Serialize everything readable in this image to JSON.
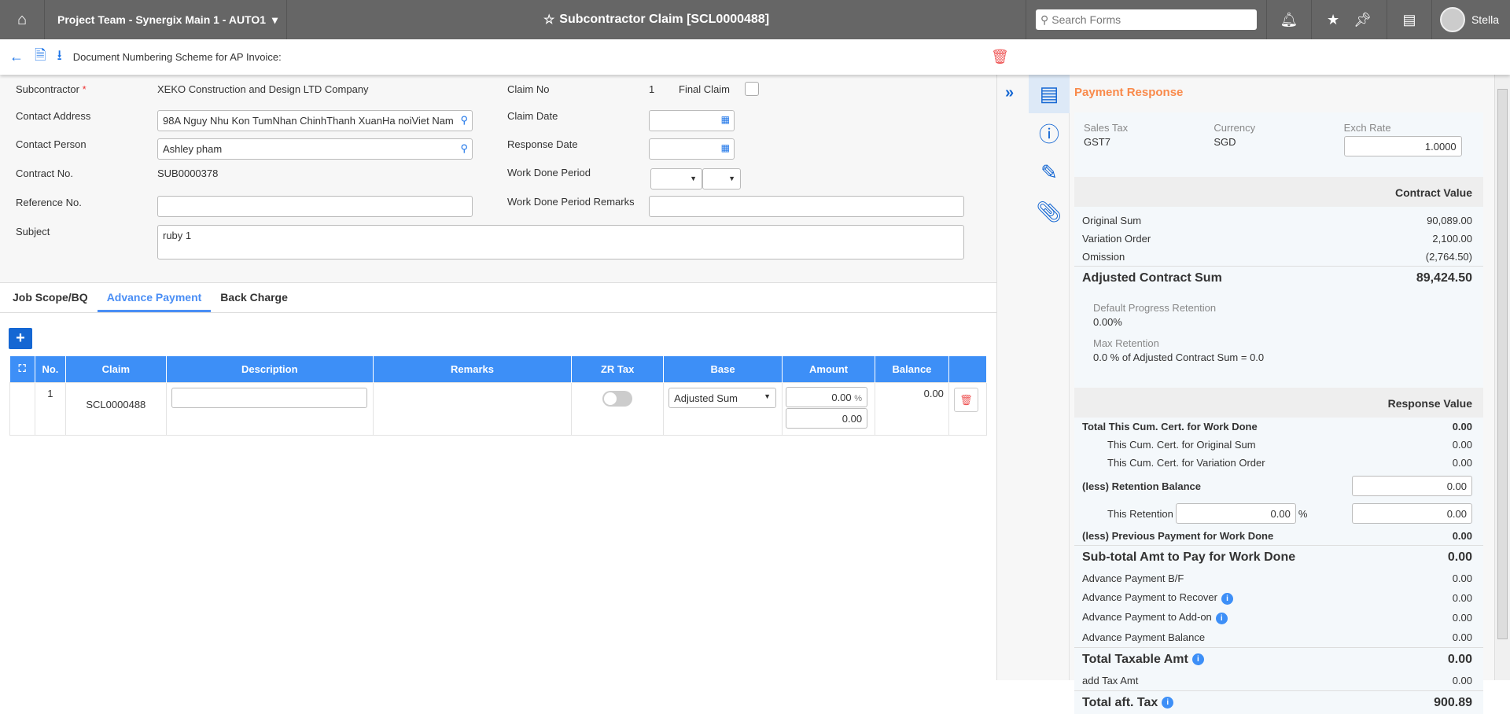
{
  "topbar": {
    "project": "Project Team - Synergix Main 1 - AUTO1",
    "title": "Subcontractor Claim [SCL0000488]",
    "search_placeholder": "Search Forms",
    "user": "Stella"
  },
  "toolbar": {
    "doc_scheme": "Document Numbering Scheme for AP Invoice:"
  },
  "form": {
    "subcontractor_label": "Subcontractor",
    "required_mark": "*",
    "subcontractor": "XEKO Construction and Design LTD Company",
    "address_label": "Contact Address",
    "address": "98A Nguy Nhu Kon TumNhan ChinhThanh XuanHa noiViet Nam",
    "person_label": "Contact Person",
    "person": "Ashley pham",
    "contract_label": "Contract No.",
    "contract": "SUB0000378",
    "reference_label": "Reference No.",
    "reference": "",
    "subject_label": "Subject",
    "subject": "ruby 1",
    "claim_no_label": "Claim No",
    "claim_no": "1",
    "final_claim_label": "Final Claim",
    "claim_date_label": "Claim Date",
    "response_date_label": "Response Date",
    "period_label": "Work Done Period",
    "period_remarks_label": "Work Done Period Remarks"
  },
  "tabs": [
    "Job Scope/BQ",
    "Advance Payment",
    "Back Charge"
  ],
  "table": {
    "headers": [
      "No.",
      "Claim",
      "Description",
      "Remarks",
      "ZR Tax",
      "Base",
      "Amount",
      "Balance"
    ],
    "rows": [
      {
        "no": "1",
        "claim": "SCL0000488",
        "description": "",
        "remarks": "",
        "base": "Adjusted Sum",
        "amount_pct": "0.00",
        "pct_sign": "%",
        "amount": "0.00",
        "balance": "0.00"
      }
    ]
  },
  "panel": {
    "title": "Payment Response",
    "sales_tax_label": "Sales Tax",
    "sales_tax": "GST7",
    "currency_label": "Currency",
    "currency": "SGD",
    "exch_label": "Exch Rate",
    "exch": "1.0000",
    "contract_value": "Contract Value",
    "original_sum_label": "Original Sum",
    "original_sum": "90,089.00",
    "vo_label": "Variation Order",
    "vo": "2,100.00",
    "omission_label": "Omission",
    "omission": "(2,764.50)",
    "adjusted_label": "Adjusted Contract Sum",
    "adjusted": "89,424.50",
    "dpr_label": "Default Progress Retention",
    "dpr": "0.00%",
    "max_ret_label": "Max Retention",
    "max_ret": "0.0 % of Adjusted Contract Sum = 0.0",
    "response_value": "Response Value",
    "rows": [
      {
        "label": "Total This Cum. Cert. for Work Done",
        "value": "0.00"
      },
      {
        "label": "This Cum. Cert. for Original Sum",
        "value": "0.00"
      },
      {
        "label": "This Cum. Cert. for Variation Order",
        "value": "0.00"
      },
      {
        "label": "(less) Retention Balance",
        "value": "0.00"
      },
      {
        "label": "This Retention",
        "pct": "0.00",
        "pct_sign": "%",
        "value": "0.00"
      },
      {
        "label": "(less) Previous Payment for Work Done",
        "value": "0.00"
      },
      {
        "label": "Sub-total Amt to Pay for Work Done",
        "value": "0.00"
      },
      {
        "label": "Advance Payment B/F",
        "value": "0.00"
      },
      {
        "label": "Advance Payment to Recover",
        "value": "0.00"
      },
      {
        "label": "Advance Payment to Add-on",
        "value": "0.00"
      },
      {
        "label": "Advance Payment Balance",
        "value": "0.00"
      },
      {
        "label": "Total Taxable Amt",
        "value": "0.00"
      },
      {
        "label": "add Tax Amt",
        "value": "0.00"
      },
      {
        "label": "Total aft. Tax",
        "value": "900.89"
      }
    ]
  }
}
